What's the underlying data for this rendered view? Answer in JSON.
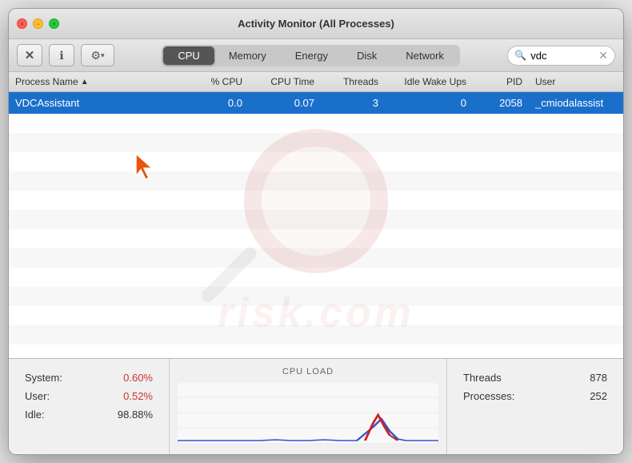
{
  "window": {
    "title": "Activity Monitor (All Processes)"
  },
  "toolbar": {
    "close_label": "×",
    "minimize_label": "−",
    "maximize_label": "+",
    "btn_x_label": "✕",
    "btn_info_label": "ℹ",
    "btn_gear_label": "⚙",
    "btn_gear_arrow": "▾",
    "tabs": [
      "CPU",
      "Memory",
      "Energy",
      "Disk",
      "Network"
    ],
    "active_tab": "CPU",
    "search_placeholder": "vdc",
    "search_value": "vdc"
  },
  "columns": [
    {
      "id": "process-name",
      "label": "Process Name",
      "sortable": true,
      "direction": "asc"
    },
    {
      "id": "cpu-pct",
      "label": "% CPU",
      "align": "right"
    },
    {
      "id": "cpu-time",
      "label": "CPU Time",
      "align": "right"
    },
    {
      "id": "threads",
      "label": "Threads",
      "align": "right"
    },
    {
      "id": "idle-wake",
      "label": "Idle Wake Ups",
      "align": "right"
    },
    {
      "id": "pid",
      "label": "PID",
      "align": "right"
    },
    {
      "id": "user",
      "label": "User",
      "align": "left"
    }
  ],
  "rows": [
    {
      "name": "VDCAssistant",
      "cpu_pct": "0.0",
      "cpu_time": "0.07",
      "threads": "3",
      "idle_wake": "0",
      "pid": "2058",
      "user": "_cmiodalassist",
      "highlighted": true
    }
  ],
  "bottom_stats": {
    "system_label": "System:",
    "system_value": "0.60%",
    "user_label": "User:",
    "user_value": "0.52%",
    "idle_label": "Idle:",
    "idle_value": "98.88%",
    "cpu_load_label": "CPU LOAD",
    "threads_label": "Threads",
    "threads_value": "878",
    "processes_label": "Processes:",
    "processes_value": "252"
  }
}
